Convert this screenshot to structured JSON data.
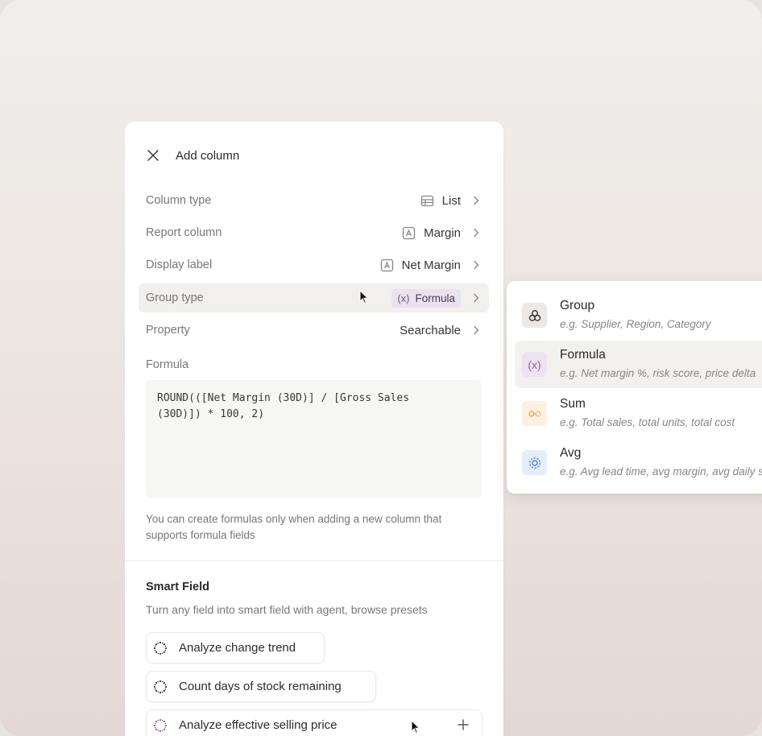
{
  "panel": {
    "title": "Add column",
    "rows": [
      {
        "label": "Column type",
        "value": "List",
        "icon": "table-icon"
      },
      {
        "label": "Report column",
        "value": "Margin",
        "icon": "text-field-icon"
      },
      {
        "label": "Display label",
        "value": "Net Margin",
        "icon": "text-field-icon"
      },
      {
        "label": "Group type",
        "value": "Formula",
        "icon": "function-icon",
        "badge_prefix": "(x)"
      },
      {
        "label": "Property",
        "value": "Searchable"
      }
    ],
    "formula": {
      "label": "Formula",
      "value": "ROUND(([Net Margin (30D)] / [Gross Sales\n(30D)]) * 100, 2)"
    },
    "hint": "You can create formulas only when adding a new column that supports formula fields",
    "smart_field": {
      "title": "Smart Field",
      "subtitle": "Turn any field into smart field with agent, browse presets",
      "presets": [
        {
          "label": "Analyze change trend"
        },
        {
          "label": "Count days of stock remaining"
        },
        {
          "label": "Analyze effective selling price"
        }
      ]
    }
  },
  "dropdown": {
    "items": [
      {
        "name": "Group",
        "desc": "e.g. Supplier, Region, Category",
        "icon": "group-icon",
        "color": "#ece8e4"
      },
      {
        "name": "Formula",
        "desc": "e.g. Net margin %, risk score, price delta",
        "icon": "function-icon",
        "color": "#ede2f1"
      },
      {
        "name": "Sum",
        "desc": "e.g. Total sales, total units, total cost",
        "icon": "sum-icon",
        "color": "#fdf0e0"
      },
      {
        "name": "Avg",
        "desc": "e.g. Avg lead time, avg margin, avg daily sales",
        "icon": "avg-icon",
        "color": "#e4edfb"
      }
    ],
    "selected": "Formula"
  },
  "colors": {
    "accent_purple": "#ebe2f0",
    "highlight_row": "#f1f0ef"
  }
}
